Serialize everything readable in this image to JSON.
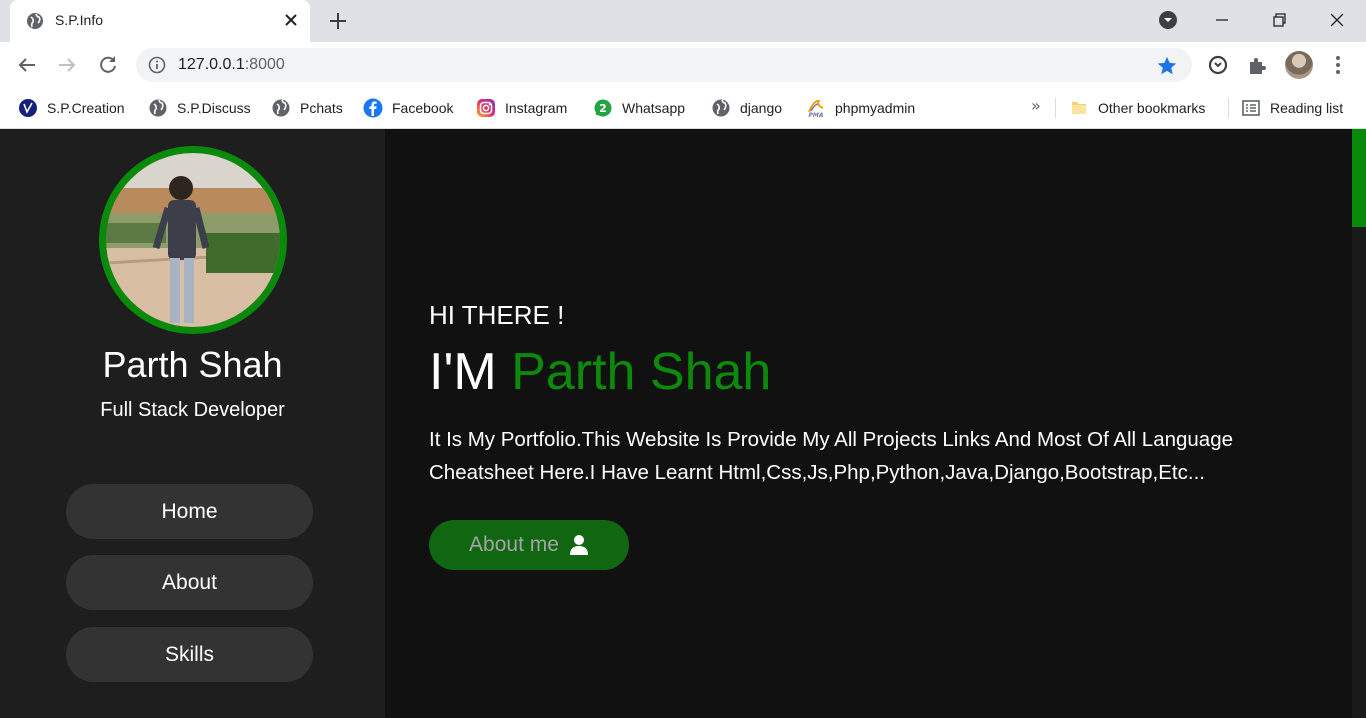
{
  "browser": {
    "tab_title": "S.P.Info",
    "url_host": "127.0.0.1",
    "url_port": ":8000",
    "bookmarks": [
      {
        "label": "S.P.Creation",
        "icon": "sp-creation-icon"
      },
      {
        "label": "S.P.Discuss",
        "icon": "globe-icon"
      },
      {
        "label": "Pchats",
        "icon": "globe-icon"
      },
      {
        "label": "Facebook",
        "icon": "facebook-icon"
      },
      {
        "label": "Instagram",
        "icon": "instagram-icon"
      },
      {
        "label": "Whatsapp",
        "icon": "whatsapp-icon"
      },
      {
        "label": "django",
        "icon": "globe-icon"
      },
      {
        "label": "phpmyadmin",
        "icon": "phpmyadmin-icon"
      }
    ],
    "more_bookmarks": "»",
    "other_bookmarks": "Other bookmarks",
    "reading_list": "Reading list"
  },
  "sidebar": {
    "name": "Parth Shah",
    "role": "Full Stack Developer",
    "nav": [
      {
        "label": "Home"
      },
      {
        "label": "About"
      },
      {
        "label": "Skills"
      }
    ]
  },
  "hero": {
    "greeting": "HI THERE !",
    "im": "I'M",
    "name": "Parth Shah",
    "description": "It Is My Portfolio.This Website Is Provide My All Projects Links And Most Of All Language Cheatsheet Here.I Have Learnt Html,Css,Js,Php,Python,Java,Django,Bootstrap,Etc...",
    "about_button": "About me"
  },
  "colors": {
    "accent": "#0a8a0a",
    "sidebar_bg": "#1e1e1e",
    "main_bg": "#111111",
    "button_bg": "#333333"
  }
}
